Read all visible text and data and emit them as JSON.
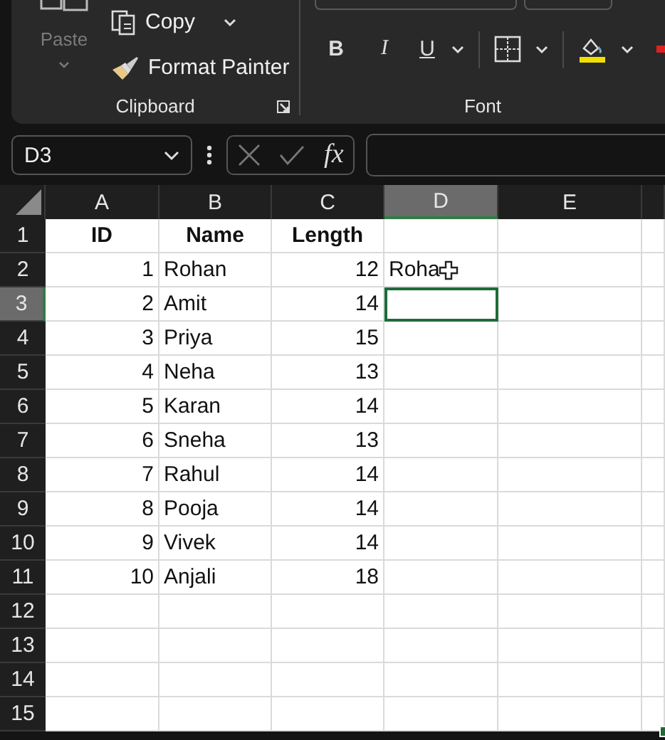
{
  "ribbon": {
    "clipboard": {
      "paste": "Paste",
      "copy": "Copy",
      "format_painter": "Format Painter",
      "label": "Clipboard"
    },
    "font": {
      "bold": "B",
      "italic": "I",
      "underline": "U",
      "label": "Font"
    }
  },
  "formula_bar": {
    "name_box": "D3",
    "fx": "fx"
  },
  "columns": [
    {
      "label": "A",
      "selected": false
    },
    {
      "label": "B",
      "selected": false
    },
    {
      "label": "C",
      "selected": false
    },
    {
      "label": "D",
      "selected": true
    },
    {
      "label": "E",
      "selected": false
    }
  ],
  "rows": [
    {
      "number": "1",
      "selected": false,
      "cells": [
        {
          "kind": "header",
          "text": "ID"
        },
        {
          "kind": "header",
          "text": "Name"
        },
        {
          "kind": "header",
          "text": "Length"
        }
      ]
    },
    {
      "number": "2",
      "selected": false,
      "cells": [
        {
          "kind": "number",
          "text": "1"
        },
        {
          "kind": "text",
          "text": "Rohan"
        },
        {
          "kind": "number",
          "text": "12"
        },
        {
          "kind": "editing",
          "text": "Roha"
        }
      ]
    },
    {
      "number": "3",
      "selected": true,
      "cells": [
        {
          "kind": "number",
          "text": "2"
        },
        {
          "kind": "text",
          "text": "Amit"
        },
        {
          "kind": "number",
          "text": "14"
        }
      ]
    },
    {
      "number": "4",
      "selected": false,
      "cells": [
        {
          "kind": "number",
          "text": "3"
        },
        {
          "kind": "text",
          "text": "Priya"
        },
        {
          "kind": "number",
          "text": "15"
        }
      ]
    },
    {
      "number": "5",
      "selected": false,
      "cells": [
        {
          "kind": "number",
          "text": "4"
        },
        {
          "kind": "text",
          "text": "Neha"
        },
        {
          "kind": "number",
          "text": "13"
        }
      ]
    },
    {
      "number": "6",
      "selected": false,
      "cells": [
        {
          "kind": "number",
          "text": "5"
        },
        {
          "kind": "text",
          "text": "Karan"
        },
        {
          "kind": "number",
          "text": "14"
        }
      ]
    },
    {
      "number": "7",
      "selected": false,
      "cells": [
        {
          "kind": "number",
          "text": "6"
        },
        {
          "kind": "text",
          "text": "Sneha"
        },
        {
          "kind": "number",
          "text": "13"
        }
      ]
    },
    {
      "number": "8",
      "selected": false,
      "cells": [
        {
          "kind": "number",
          "text": "7"
        },
        {
          "kind": "text",
          "text": "Rahul"
        },
        {
          "kind": "number",
          "text": "14"
        }
      ]
    },
    {
      "number": "9",
      "selected": false,
      "cells": [
        {
          "kind": "number",
          "text": "8"
        },
        {
          "kind": "text",
          "text": "Pooja"
        },
        {
          "kind": "number",
          "text": "14"
        }
      ]
    },
    {
      "number": "10",
      "selected": false,
      "cells": [
        {
          "kind": "number",
          "text": "9"
        },
        {
          "kind": "text",
          "text": "Vivek"
        },
        {
          "kind": "number",
          "text": "14"
        }
      ]
    },
    {
      "number": "11",
      "selected": false,
      "cells": [
        {
          "kind": "number",
          "text": "10"
        },
        {
          "kind": "text",
          "text": "Anjali"
        },
        {
          "kind": "number",
          "text": "18"
        }
      ]
    },
    {
      "number": "12",
      "selected": false
    },
    {
      "number": "13",
      "selected": false
    },
    {
      "number": "14",
      "selected": false
    },
    {
      "number": "15",
      "selected": false
    }
  ]
}
